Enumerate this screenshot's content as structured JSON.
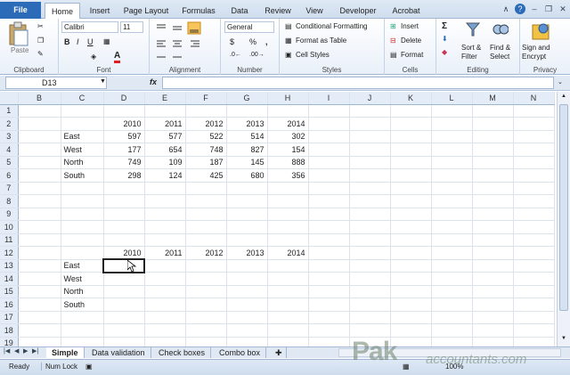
{
  "ribbon_tabs": [
    {
      "label": "File",
      "x": 0
    },
    {
      "label": "Home"
    },
    {
      "label": "Insert"
    },
    {
      "label": "Page Layout"
    },
    {
      "label": "Formulas"
    },
    {
      "label": "Data"
    },
    {
      "label": "Review"
    },
    {
      "label": "View"
    },
    {
      "label": "Developer"
    },
    {
      "label": "Acrobat"
    }
  ],
  "ribbon": {
    "clipboard": {
      "label": "Clipboard",
      "paste": "Paste"
    },
    "font": {
      "label": "Font",
      "name": "Calibri",
      "size": "11"
    },
    "alignment": {
      "label": "Alignment"
    },
    "number": {
      "label": "Number",
      "format": "General",
      "currency": "$",
      "percent": "%",
      "comma": ","
    },
    "styles": {
      "label": "Styles",
      "conditional": "Conditional Formatting",
      "format_table": "Format as Table",
      "cell_styles": "Cell Styles"
    },
    "cells": {
      "label": "Cells",
      "insert": "Insert",
      "delete": "Delete",
      "format": "Format"
    },
    "editing": {
      "label": "Editing",
      "sort": "Sort &",
      "sort2": "Filter",
      "find": "Find &",
      "find2": "Select"
    },
    "privacy": {
      "label": "Privacy",
      "sign": "Sign and",
      "sign2": "Encrypt"
    }
  },
  "formula_bar": {
    "name_box": "D13",
    "fx": "fx",
    "content": ""
  },
  "columns": [
    "B",
    "C",
    "D",
    "E",
    "F",
    "G",
    "H",
    "I",
    "J",
    "K",
    "L",
    "M",
    "N"
  ],
  "rows": [
    [
      "",
      "",
      "",
      "",
      "",
      "",
      "",
      "",
      "",
      "",
      "",
      "",
      ""
    ],
    [
      "",
      "",
      "2010",
      "2011",
      "2012",
      "2013",
      "2014",
      "",
      "",
      "",
      "",
      "",
      ""
    ],
    [
      "",
      "East",
      "597",
      "577",
      "522",
      "514",
      "302",
      "",
      "",
      "",
      "",
      "",
      ""
    ],
    [
      "",
      "West",
      "177",
      "654",
      "748",
      "827",
      "154",
      "",
      "",
      "",
      "",
      "",
      ""
    ],
    [
      "",
      "North",
      "749",
      "109",
      "187",
      "145",
      "888",
      "",
      "",
      "",
      "",
      "",
      ""
    ],
    [
      "",
      "South",
      "298",
      "124",
      "425",
      "680",
      "356",
      "",
      "",
      "",
      "",
      "",
      ""
    ],
    [
      "",
      "",
      "",
      "",
      "",
      "",
      "",
      "",
      "",
      "",
      "",
      "",
      ""
    ],
    [
      "",
      "",
      "",
      "",
      "",
      "",
      "",
      "",
      "",
      "",
      "",
      "",
      ""
    ],
    [
      "",
      "",
      "",
      "",
      "",
      "",
      "",
      "",
      "",
      "",
      "",
      "",
      ""
    ],
    [
      "",
      "",
      "",
      "",
      "",
      "",
      "",
      "",
      "",
      "",
      "",
      "",
      ""
    ],
    [
      "",
      "",
      "",
      "",
      "",
      "",
      "",
      "",
      "",
      "",
      "",
      "",
      ""
    ],
    [
      "",
      "",
      "2010",
      "2011",
      "2012",
      "2013",
      "2014",
      "",
      "",
      "",
      "",
      "",
      ""
    ],
    [
      "",
      "East",
      "",
      "",
      "",
      "",
      "",
      "",
      "",
      "",
      "",
      "",
      ""
    ],
    [
      "",
      "West",
      "",
      "",
      "",
      "",
      "",
      "",
      "",
      "",
      "",
      "",
      ""
    ],
    [
      "",
      "North",
      "",
      "",
      "",
      "",
      "",
      "",
      "",
      "",
      "",
      "",
      ""
    ],
    [
      "",
      "South",
      "",
      "",
      "",
      "",
      "",
      "",
      "",
      "",
      "",
      "",
      ""
    ],
    [
      "",
      "",
      "",
      "",
      "",
      "",
      "",
      "",
      "",
      "",
      "",
      "",
      ""
    ],
    [
      "",
      "",
      "",
      "",
      "",
      "",
      "",
      "",
      "",
      "",
      "",
      "",
      ""
    ],
    [
      "",
      "",
      "",
      "",
      "",
      "",
      "",
      "",
      "",
      "",
      "",
      "",
      ""
    ]
  ],
  "sheet_tabs": [
    "Simple",
    "Data validation",
    "Check boxes",
    "Combo box"
  ],
  "active_sheet": "Simple",
  "status": {
    "ready": "Ready",
    "num_lock": "Num Lock",
    "zoom": "100%"
  },
  "watermark": {
    "main": "Pak",
    "sub": "accountants.com"
  }
}
